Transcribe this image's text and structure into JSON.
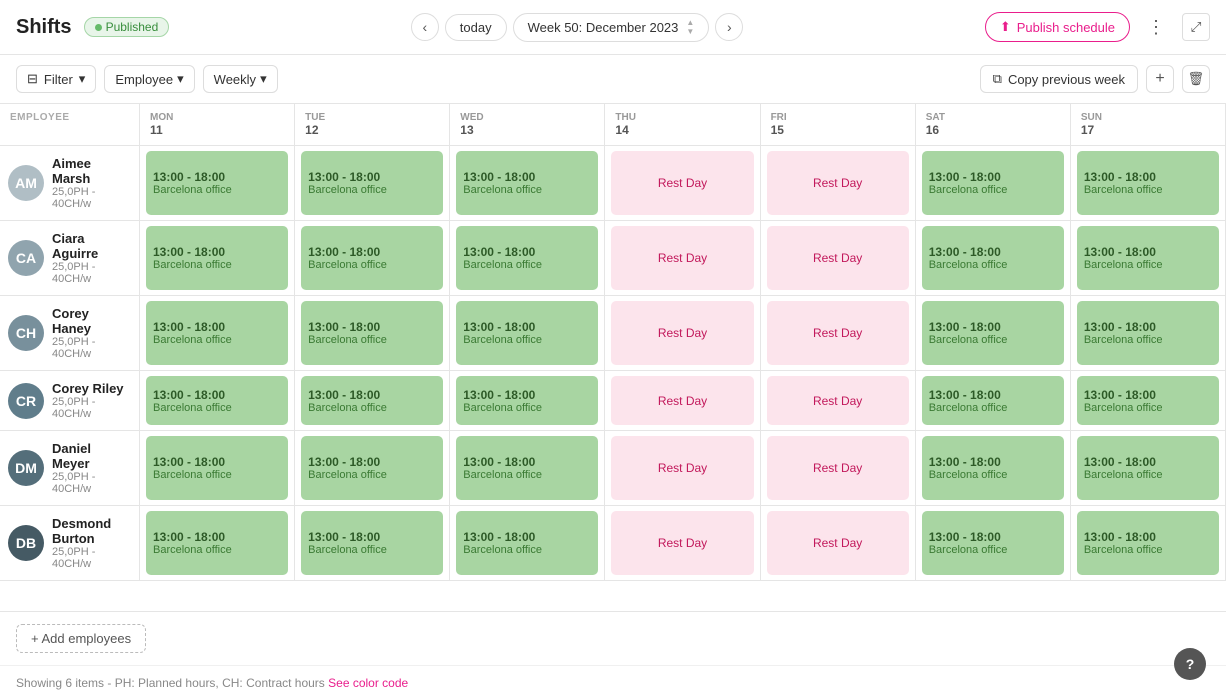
{
  "header": {
    "title": "Shifts",
    "badge": "Published",
    "nav_today": "today",
    "week_label": "Week 50: December 2023",
    "btn_publish": "Publish schedule",
    "prev_icon": "‹",
    "next_icon": "›"
  },
  "toolbar": {
    "filter_label": "Filter",
    "employee_label": "Employee",
    "weekly_label": "Weekly",
    "copy_week_label": "Copy previous week"
  },
  "columns": [
    {
      "id": "employee",
      "label": "EMPLOYEE",
      "day": "",
      "num": ""
    },
    {
      "id": "mon",
      "label": "MON 11",
      "day": "MON",
      "num": "11"
    },
    {
      "id": "tue",
      "label": "TUE 12",
      "day": "TUE",
      "num": "12"
    },
    {
      "id": "wed",
      "label": "WED 13",
      "day": "WED",
      "num": "13"
    },
    {
      "id": "thu",
      "label": "THU 14",
      "day": "THU",
      "num": "14"
    },
    {
      "id": "fri",
      "label": "FRI 15",
      "day": "FRI",
      "num": "15"
    },
    {
      "id": "sat",
      "label": "SAT 16",
      "day": "SAT",
      "num": "16"
    },
    {
      "id": "sun",
      "label": "SUN 17",
      "day": "SUN",
      "num": "17"
    }
  ],
  "employees": [
    {
      "name": "Aimee Marsh",
      "meta": "25,0PH - 40CH/w",
      "avatar_color": "#b0bec5",
      "initials": "AM",
      "shifts": [
        "shift",
        "shift",
        "shift",
        "rest",
        "rest",
        "shift",
        "shift"
      ]
    },
    {
      "name": "Ciara Aguirre",
      "meta": "25,0PH - 40CH/w",
      "avatar_color": "#90a4ae",
      "initials": "CA",
      "shifts": [
        "shift",
        "shift",
        "shift",
        "rest",
        "rest",
        "shift",
        "shift"
      ]
    },
    {
      "name": "Corey Haney",
      "meta": "25,0PH - 40CH/w",
      "avatar_color": "#78909c",
      "initials": "CH",
      "shifts": [
        "shift",
        "shift",
        "shift",
        "rest",
        "rest",
        "shift",
        "shift"
      ]
    },
    {
      "name": "Corey Riley",
      "meta": "25,0PH - 40CH/w",
      "avatar_color": "#607d8b",
      "initials": "CR",
      "shifts": [
        "shift",
        "shift",
        "shift",
        "rest",
        "rest",
        "shift",
        "shift"
      ]
    },
    {
      "name": "Daniel Meyer",
      "meta": "25,0PH - 40CH/w",
      "avatar_color": "#546e7a",
      "initials": "DM",
      "shifts": [
        "shift",
        "shift",
        "shift",
        "rest",
        "rest",
        "shift",
        "shift"
      ]
    },
    {
      "name": "Desmond Burton",
      "meta": "25,0PH - 40CH/w",
      "avatar_color": "#455a64",
      "initials": "DB",
      "shifts": [
        "shift",
        "shift",
        "shift",
        "rest",
        "rest",
        "shift",
        "shift"
      ]
    }
  ],
  "shift_time": "13:00 - 18:00",
  "shift_location": "Barcelona office",
  "rest_label": "Rest Day",
  "add_employees": "+ Add employees",
  "status_text": "Showing 6 items - PH: Planned hours, CH: Contract hours",
  "color_code_link": "See color code",
  "help_icon": "?"
}
